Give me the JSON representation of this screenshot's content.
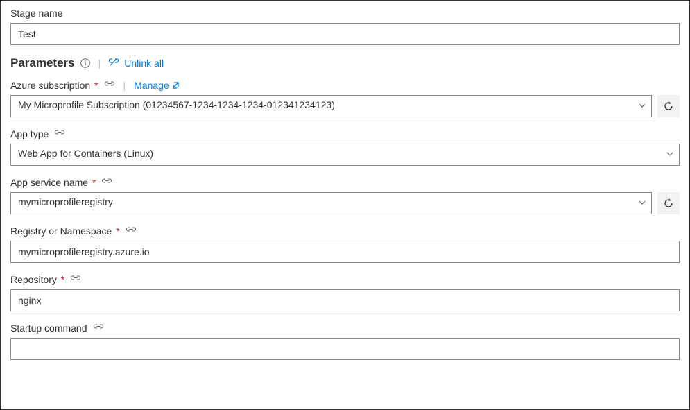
{
  "stage_name": {
    "label": "Stage name",
    "value": "Test"
  },
  "parameters_section": {
    "title": "Parameters",
    "unlink_all_label": "Unlink all"
  },
  "azure_subscription": {
    "label": "Azure subscription",
    "manage_label": "Manage",
    "value": "My Microprofile Subscription (01234567-1234-1234-1234-012341234123)"
  },
  "app_type": {
    "label": "App type",
    "value": "Web App for Containers (Linux)"
  },
  "app_service_name": {
    "label": "App service name",
    "value": "mymicroprofileregistry"
  },
  "registry_namespace": {
    "label": "Registry or Namespace",
    "value": "mymicroprofileregistry.azure.io"
  },
  "repository": {
    "label": "Repository",
    "value": "nginx"
  },
  "startup_command": {
    "label": "Startup command",
    "value": ""
  }
}
